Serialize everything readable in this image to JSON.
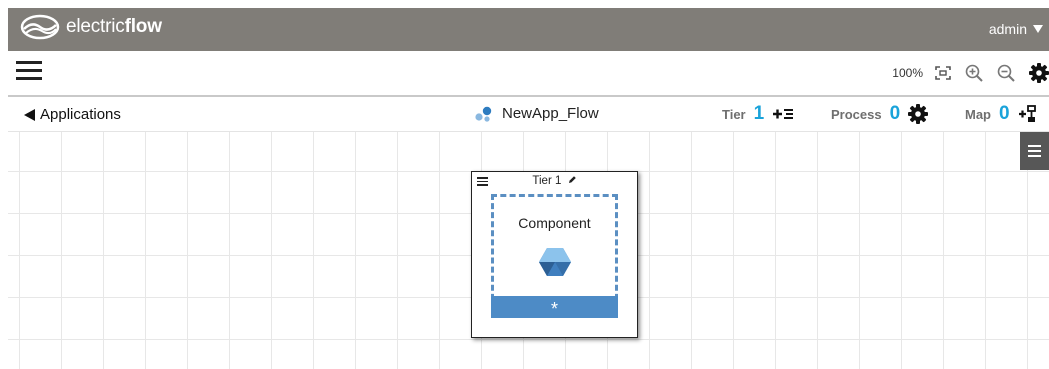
{
  "header": {
    "logo_prefix": "electric",
    "logo_suffix": "flow",
    "user": "admin"
  },
  "toolbar": {
    "zoom": "100%",
    "icons": [
      "fit-screen-icon",
      "zoom-in-icon",
      "zoom-out-icon",
      "gear-icon"
    ]
  },
  "subbar": {
    "back_label": "Applications",
    "app_name": "NewApp_Flow",
    "tier_label": "Tier",
    "tier_count": "1",
    "process_label": "Process",
    "process_count": "0",
    "map_label": "Map",
    "map_count": "0"
  },
  "tier": {
    "title": "Tier 1",
    "component_label": "Component",
    "add_symbol": "*"
  },
  "colors": {
    "header_bg": "#807d78",
    "accent_blue": "#1aa3da",
    "component_blue": "#4d8bc6"
  }
}
